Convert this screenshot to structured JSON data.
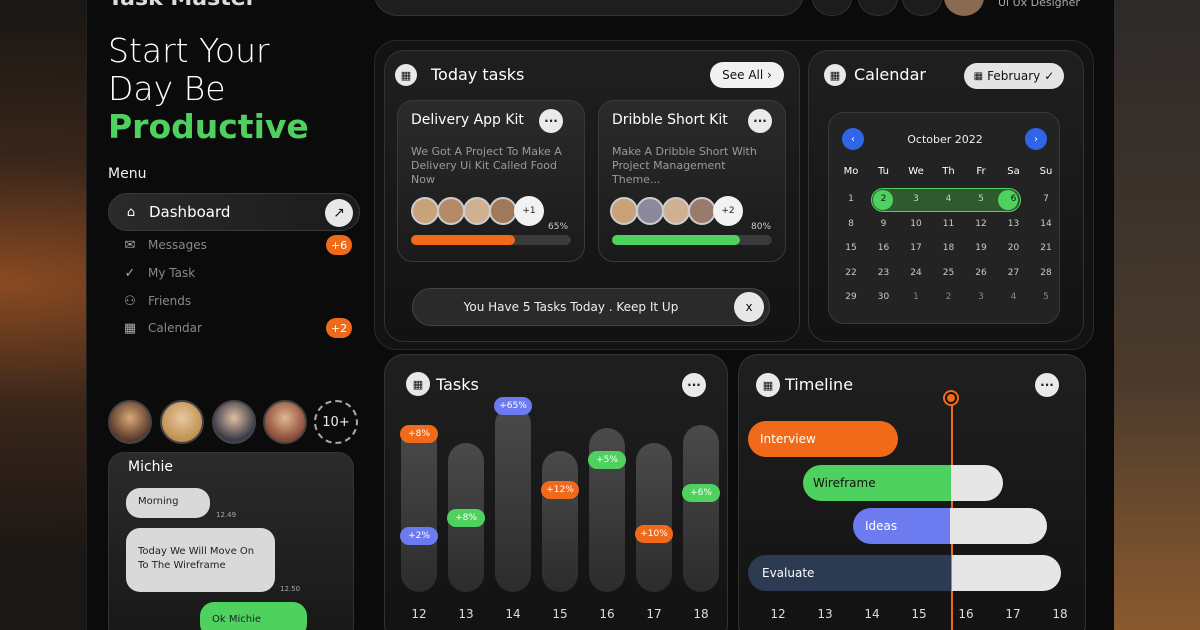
{
  "header": {
    "app_name": "Task Master",
    "role": "Ui Ux Designer"
  },
  "hero": {
    "line1": "Start Your",
    "line2": "Day Be",
    "line3": "Productive"
  },
  "menu": {
    "title": "Menu",
    "items": [
      {
        "label": "Dashboard",
        "icon": "home-icon"
      },
      {
        "label": "Messages",
        "icon": "mail-icon",
        "badge": "+6"
      },
      {
        "label": "My Task",
        "icon": "check-icon"
      },
      {
        "label": "Friends",
        "icon": "users-icon"
      },
      {
        "label": "Calendar",
        "icon": "calendar-icon",
        "badge": "+2"
      }
    ]
  },
  "team": {
    "more": "10+"
  },
  "chat": {
    "name": "Michie",
    "messages": [
      {
        "text": "Morning",
        "time": "12.49"
      },
      {
        "text": "Today We Will Move On To The Wireframe",
        "time": "12.50"
      },
      {
        "text": "Ok Michie"
      }
    ]
  },
  "today": {
    "title": "Today tasks",
    "see_all": "See All",
    "notice": "You Have 5 Tasks Today . Keep It Up",
    "close": "x",
    "cards": [
      {
        "title": "Delivery App Kit",
        "desc": "We Got A Project To Make A Delivery Ui Kit Called Food Now",
        "extra": "+1",
        "percent": "65%",
        "progress": 0.65,
        "color": "#f06a1a"
      },
      {
        "title": "Dribble Short Kit",
        "desc": "Make A Dribble Short With Project Management Theme...",
        "extra": "+2",
        "percent": "80%",
        "progress": 0.8,
        "color": "#4fd15f"
      }
    ]
  },
  "calendar": {
    "title": "Calendar",
    "month_btn": "February",
    "month_label": "October 2022",
    "dow": [
      "Mo",
      "Tu",
      "We",
      "Th",
      "Fr",
      "Sa",
      "Su"
    ],
    "weeks": [
      [
        "1",
        "2",
        "3",
        "4",
        "5",
        "6",
        "7"
      ],
      [
        "8",
        "9",
        "10",
        "11",
        "12",
        "13",
        "14"
      ],
      [
        "15",
        "16",
        "17",
        "18",
        "19",
        "20",
        "21"
      ],
      [
        "22",
        "23",
        "24",
        "25",
        "26",
        "27",
        "28"
      ],
      [
        "29",
        "30",
        "1",
        "2",
        "3",
        "4",
        "5"
      ]
    ]
  },
  "chart_data": {
    "type": "bar",
    "title": "Tasks",
    "categories": [
      "12",
      "13",
      "14",
      "15",
      "16",
      "17",
      "18"
    ],
    "bar_top": [
      0.9,
      0.8,
      1.0,
      0.76,
      0.88,
      0.8,
      0.9
    ],
    "labels": [
      {
        "items": [
          {
            "text": "+8%",
            "color": "#f06a1a",
            "pos": 0.85
          },
          {
            "text": "+2%",
            "color": "#6c7cf0",
            "pos": 0.3
          }
        ]
      },
      {
        "items": [
          {
            "text": "+8%",
            "color": "#4fd15f",
            "pos": 0.4
          }
        ]
      },
      {
        "items": [
          {
            "text": "+65%",
            "color": "#6c7cf0",
            "pos": 1.0
          }
        ]
      },
      {
        "items": [
          {
            "text": "+12%",
            "color": "#f06a1a",
            "pos": 0.55
          }
        ]
      },
      {
        "items": [
          {
            "text": "+5%",
            "color": "#4fd15f",
            "pos": 0.71
          }
        ]
      },
      {
        "items": [
          {
            "text": "+10%",
            "color": "#f06a1a",
            "pos": 0.31
          }
        ]
      },
      {
        "items": [
          {
            "text": "+6%",
            "color": "#4fd15f",
            "pos": 0.53
          }
        ]
      }
    ]
  },
  "timeline": {
    "title": "Timeline",
    "days": [
      "12",
      "13",
      "14",
      "15",
      "16",
      "17",
      "18"
    ],
    "tasks": [
      {
        "label": "Interview",
        "color": "#f06a1a"
      },
      {
        "label": "Wireframe",
        "color": "#4fd15f"
      },
      {
        "label": "Ideas",
        "color": "#6c7cf0"
      },
      {
        "label": "Evaluate",
        "color": "#2c3a52"
      }
    ]
  }
}
